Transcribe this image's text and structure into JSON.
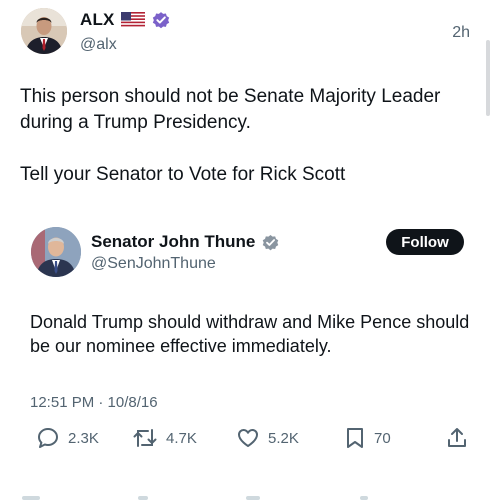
{
  "post": {
    "author": {
      "display_name": "ALX",
      "handle": "@alx"
    },
    "time": "2h",
    "text": "This person should not be Senate Majority Leader during a Trump Presidency.\n\nTell your Senator to Vote for Rick Scott"
  },
  "quoted": {
    "author": {
      "display_name": "Senator John Thune",
      "handle": "@SenJohnThune"
    },
    "follow_label": "Follow",
    "text": "Donald Trump should withdraw and Mike Pence should be our nominee effective immediately.",
    "date": "12:51 PM · 10/8/16",
    "stats": {
      "replies": "2.3K",
      "reposts": "4.7K",
      "likes": "5.2K",
      "bookmarks": "70"
    }
  },
  "icons": {
    "flag": "us-flag-icon",
    "verified": "verified-badge-icon",
    "reply": "reply-icon",
    "repost": "repost-icon",
    "like": "like-icon",
    "bookmark": "bookmark-icon",
    "share": "share-icon"
  },
  "colors": {
    "text": "#0f1419",
    "secondary": "#536471",
    "verified_badge": "#7b61c9",
    "follow_button": "#0f1419"
  }
}
